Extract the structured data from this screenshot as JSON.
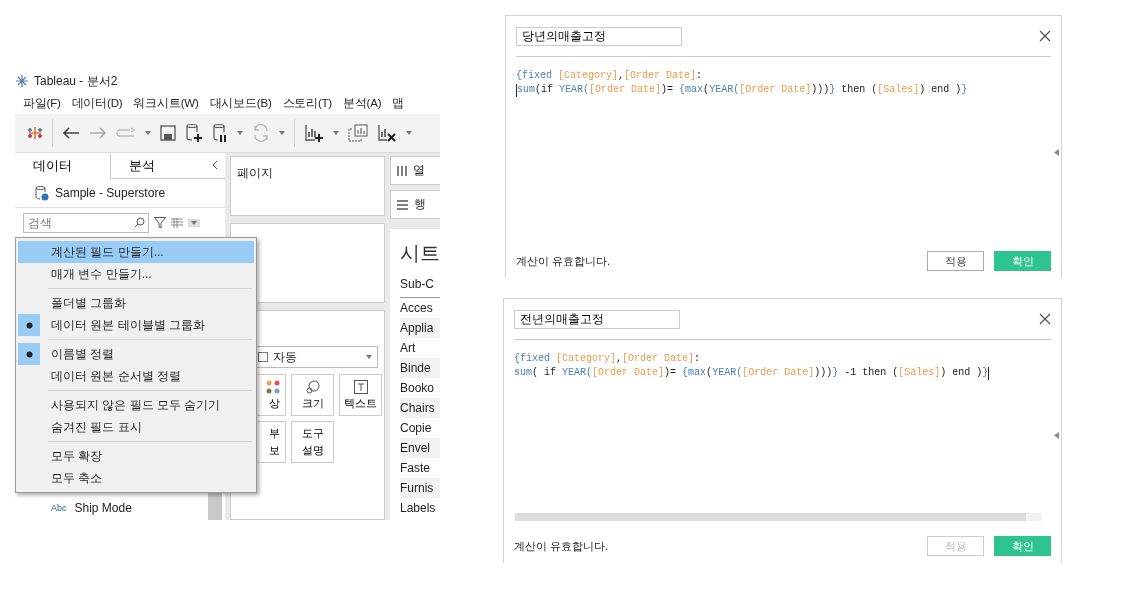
{
  "left_window": {
    "title": "Tableau - 분서2",
    "menu": [
      "파일(F)",
      "데이터(D)",
      "워크시트(W)",
      "대시보드(B)",
      "스토리(T)",
      "분석(A)",
      "맵"
    ],
    "data_tabs": [
      {
        "label": "데이터",
        "selected": true
      },
      {
        "label": "분석",
        "selected": false
      }
    ],
    "data_source": "Sample - Superstore",
    "search": {
      "placeholder": "검색"
    },
    "fields": [
      {
        "type": "Abc",
        "name": "Ship Mode"
      }
    ],
    "context_menu": [
      [
        {
          "label": "계산된 필드 만들기...",
          "selected": true,
          "checked": false
        },
        {
          "label": "매개 변수 만들기...",
          "selected": false,
          "checked": false
        }
      ],
      [
        {
          "label": "폴더별 그룹화",
          "selected": false,
          "checked": false
        },
        {
          "label": "데이터 원본 테이블별 그룹화",
          "selected": false,
          "checked": true
        }
      ],
      [
        {
          "label": "이름별 정렬",
          "selected": false,
          "checked": true
        },
        {
          "label": "데이터 원본 순서별 정렬",
          "selected": false,
          "checked": false
        }
      ],
      [
        {
          "label": "사용되지 않은 필드 모두 숨기기",
          "selected": false,
          "checked": false
        },
        {
          "label": "숨겨진 필드 표시",
          "selected": false,
          "checked": false
        }
      ],
      [
        {
          "label": "모두 확장",
          "selected": false,
          "checked": false
        },
        {
          "label": "모두 축소",
          "selected": false,
          "checked": false
        }
      ]
    ],
    "pages_card": {
      "title": "페이지"
    },
    "marks": {
      "type": "자동",
      "buttons": [
        {
          "kind": "color",
          "lines": [
            "상"
          ]
        },
        {
          "kind": "size",
          "lines": [
            "크기"
          ]
        },
        {
          "kind": "text",
          "lines": [
            "텍스트"
          ]
        },
        {
          "kind": "detail",
          "lines": [
            "부",
            "보"
          ]
        },
        {
          "kind": "tooltip",
          "lines": [
            "도구",
            "설명"
          ]
        }
      ]
    },
    "shelves": [
      {
        "kind": "columns",
        "label": "열"
      },
      {
        "kind": "rows",
        "label": "행"
      }
    ],
    "sheet": {
      "title": "시트",
      "column_header": "Sub-C",
      "rows": [
        "Acces",
        "Applia",
        "Art",
        "Binde",
        "Booko",
        "Chairs",
        "Copie",
        "Envel",
        "Faste",
        "Furnis",
        "Labels"
      ]
    }
  },
  "dialogs": [
    {
      "name": "당년의매출고정",
      "horizontal_scrollbar": false,
      "formula": [
        {
          "cursor_before": false,
          "cursor_after": false,
          "tokens": [
            {
              "t": "{fixed ",
              "kind": "keyword"
            },
            {
              "t": "[Category]",
              "kind": "field"
            },
            {
              "t": ",",
              "kind": "plain"
            },
            {
              "t": "[Order Date]",
              "kind": "field"
            },
            {
              "t": ":",
              "kind": "plain"
            }
          ]
        },
        {
          "cursor_before": true,
          "cursor_after": false,
          "tokens": [
            {
              "t": "sum",
              "kind": "keyword"
            },
            {
              "t": "(if ",
              "kind": "plain"
            },
            {
              "t": "YEAR",
              "kind": "keyword"
            },
            {
              "t": "(",
              "kind": "keyword"
            },
            {
              "t": "[Order Date]",
              "kind": "field"
            },
            {
              "t": ")= ",
              "kind": "plain"
            },
            {
              "t": "{max",
              "kind": "keyword"
            },
            {
              "t": "(",
              "kind": "plain"
            },
            {
              "t": "YEAR",
              "kind": "keyword"
            },
            {
              "t": "(",
              "kind": "keyword"
            },
            {
              "t": "[Order Date]",
              "kind": "field"
            },
            {
              "t": ")))",
              "kind": "plain"
            },
            {
              "t": "}",
              "kind": "keyword"
            },
            {
              "t": " then (",
              "kind": "plain"
            },
            {
              "t": "[Sales]",
              "kind": "field"
            },
            {
              "t": ") end )",
              "kind": "plain"
            },
            {
              "t": "}",
              "kind": "keyword"
            }
          ]
        }
      ],
      "status": "계산이 유효합니다.",
      "buttons": [
        {
          "kind": "apply",
          "label": "적용",
          "disabled": false
        },
        {
          "kind": "ok",
          "label": "확인",
          "disabled": false
        }
      ]
    },
    {
      "name": "전년의매출고정",
      "horizontal_scrollbar": true,
      "formula": [
        {
          "cursor_before": false,
          "cursor_after": false,
          "tokens": [
            {
              "t": "{fixed ",
              "kind": "keyword"
            },
            {
              "t": "[Category]",
              "kind": "field"
            },
            {
              "t": ",",
              "kind": "plain"
            },
            {
              "t": "[Order Date]",
              "kind": "field"
            },
            {
              "t": ":",
              "kind": "plain"
            }
          ]
        },
        {
          "cursor_before": false,
          "cursor_after": true,
          "tokens": [
            {
              "t": "sum",
              "kind": "keyword"
            },
            {
              "t": "( if ",
              "kind": "plain"
            },
            {
              "t": "YEAR",
              "kind": "keyword"
            },
            {
              "t": "(",
              "kind": "keyword"
            },
            {
              "t": "[Order Date]",
              "kind": "field"
            },
            {
              "t": ")= ",
              "kind": "plain"
            },
            {
              "t": "{max",
              "kind": "keyword"
            },
            {
              "t": "(",
              "kind": "plain"
            },
            {
              "t": "YEAR",
              "kind": "keyword"
            },
            {
              "t": "(",
              "kind": "keyword"
            },
            {
              "t": "[Order Date]",
              "kind": "field"
            },
            {
              "t": ")))",
              "kind": "plain"
            },
            {
              "t": "}",
              "kind": "keyword"
            },
            {
              "t": " -1 then (",
              "kind": "plain"
            },
            {
              "t": "[Sales]",
              "kind": "field"
            },
            {
              "t": ") end )",
              "kind": "plain"
            },
            {
              "t": "}",
              "kind": "keyword"
            }
          ]
        }
      ],
      "status": "계산이 유효합니다.",
      "buttons": [
        {
          "kind": "apply",
          "label": "적용",
          "disabled": true
        },
        {
          "kind": "ok",
          "label": "확인",
          "disabled": false
        }
      ]
    }
  ]
}
